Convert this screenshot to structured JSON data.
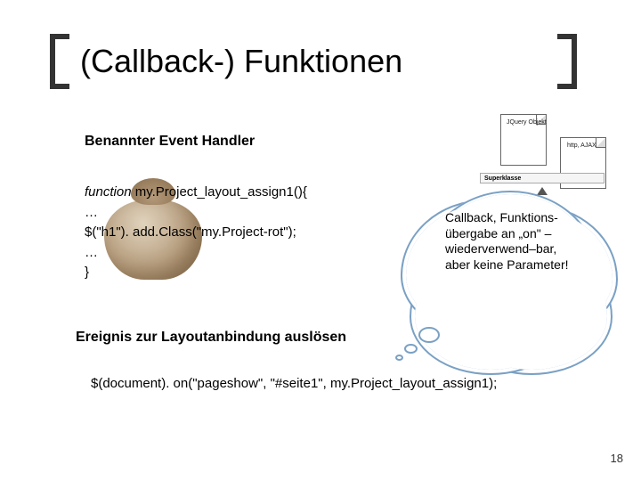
{
  "title": "(Callback-) Funktionen",
  "sub1": "Benannter Event Handler",
  "code1": {
    "l1a": "function",
    "l1b": " my.Project_layout_assign1(){",
    "l2": " …",
    "l3": " $(\"h1\"). add.Class(\"my.Project-rot\");",
    "l4": " …",
    "l5": "}"
  },
  "sub2": "Ereignis zur Layoutanbindung auslösen",
  "code2": "$(document). on(\"pageshow\", \"#seite1\", my.Project_layout_assign1);",
  "diagram": {
    "caption_a": "JQuery Objekt",
    "caption_b": "http, AJAX",
    "bar": "Superklasse"
  },
  "cloud": "Callback, Funktions-übergabe an „on\" – wiederverwend–bar, aber keine Parameter!",
  "page": "18"
}
